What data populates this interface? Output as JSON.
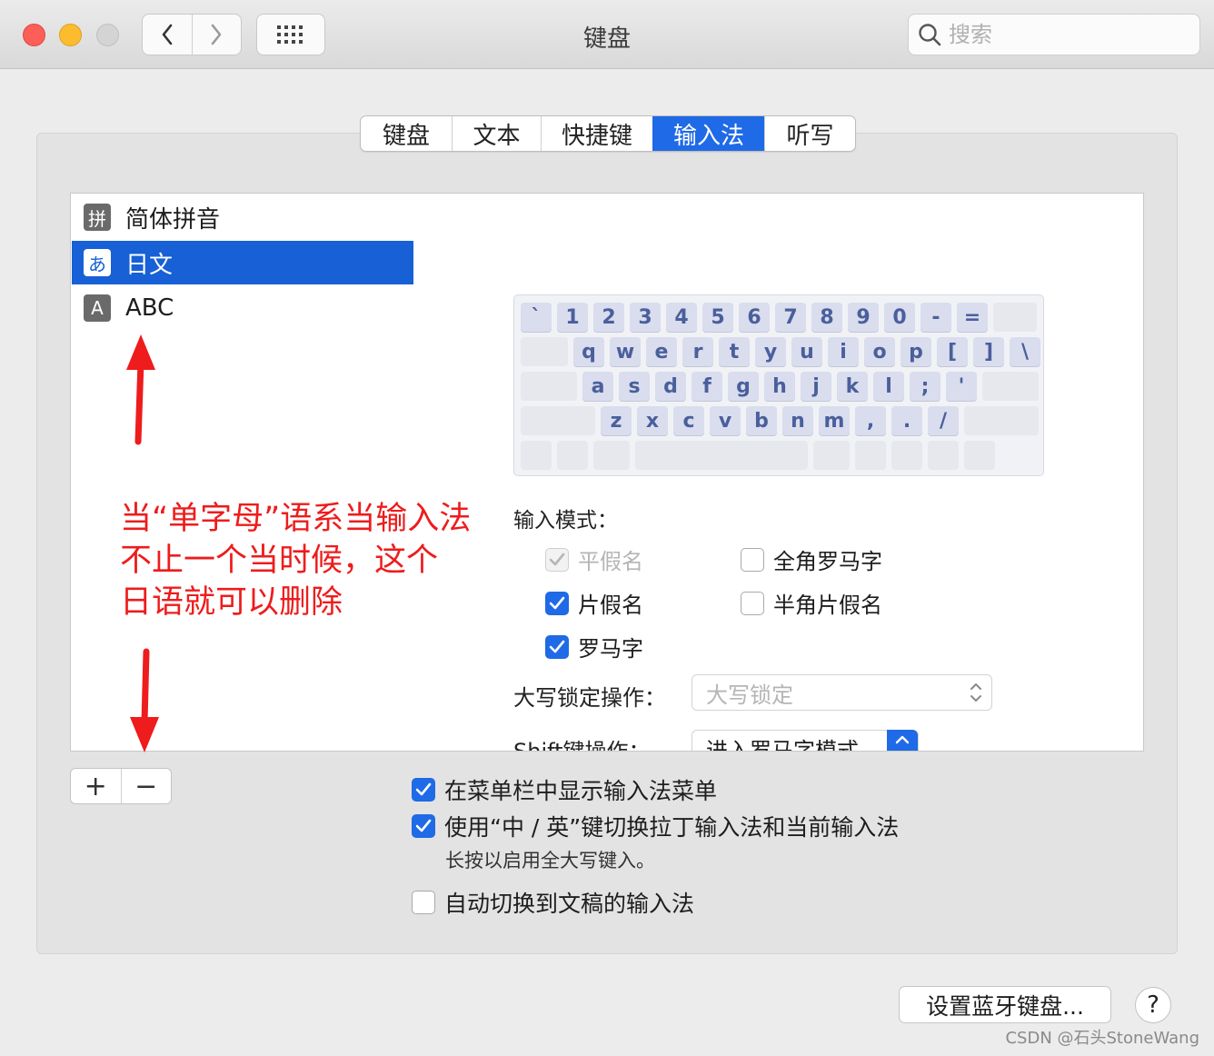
{
  "window": {
    "title": "键盘",
    "search_placeholder": "搜索"
  },
  "tabs": [
    {
      "label": "键盘",
      "active": false
    },
    {
      "label": "文本",
      "active": false
    },
    {
      "label": "快捷键",
      "active": false
    },
    {
      "label": "输入法",
      "active": true
    },
    {
      "label": "听写",
      "active": false
    }
  ],
  "input_sources": [
    {
      "icon": "拼",
      "icon_name": "pinyin-icon",
      "label": "简体拼音",
      "selected": false
    },
    {
      "icon": "あ",
      "icon_name": "hiragana-icon",
      "label": "日文",
      "selected": true
    },
    {
      "icon": "A",
      "icon_name": "abc-icon",
      "label": "ABC",
      "selected": false
    }
  ],
  "list_buttons": {
    "add": "+",
    "remove": "−"
  },
  "keyboard": {
    "row1": [
      "`",
      "1",
      "2",
      "3",
      "4",
      "5",
      "6",
      "7",
      "8",
      "9",
      "0",
      "-",
      "="
    ],
    "row2": [
      "q",
      "w",
      "e",
      "r",
      "t",
      "y",
      "u",
      "i",
      "o",
      "p",
      "[",
      "]",
      "\\"
    ],
    "row3": [
      "a",
      "s",
      "d",
      "f",
      "g",
      "h",
      "j",
      "k",
      "l",
      ";",
      "'"
    ],
    "row4": [
      "z",
      "x",
      "c",
      "v",
      "b",
      "n",
      "m",
      ",",
      ".",
      "/"
    ]
  },
  "input_modes": {
    "label": "输入模式：",
    "options": [
      {
        "label": "平假名",
        "checked": true,
        "disabled": true
      },
      {
        "label": "全角罗马字",
        "checked": false,
        "disabled": false
      },
      {
        "label": "片假名",
        "checked": true,
        "disabled": false
      },
      {
        "label": "半角片假名",
        "checked": false,
        "disabled": false
      },
      {
        "label": "罗马字",
        "checked": true,
        "disabled": false
      }
    ]
  },
  "caps_lock": {
    "label": "大写锁定操作：",
    "value": "大写锁定"
  },
  "shift": {
    "label": "Shift键操作：",
    "value": "进入罗马字模式"
  },
  "bottom_options": [
    {
      "label": "在菜单栏中显示输入法菜单",
      "checked": true
    },
    {
      "label": "使用“中 / 英”键切换拉丁输入法和当前输入法",
      "checked": true
    },
    {
      "label": "自动切换到文稿的输入法",
      "checked": false
    }
  ],
  "hint": "长按以启用全大写键入。",
  "bluetooth_button": "设置蓝牙键盘...",
  "help": "?",
  "annotation": {
    "lines": [
      "当“单字母”语系当输入法",
      "不止一个当时候，这个",
      "日语就可以删除"
    ],
    "color": "#ee1c1c"
  },
  "watermark": "CSDN @石头StoneWang"
}
